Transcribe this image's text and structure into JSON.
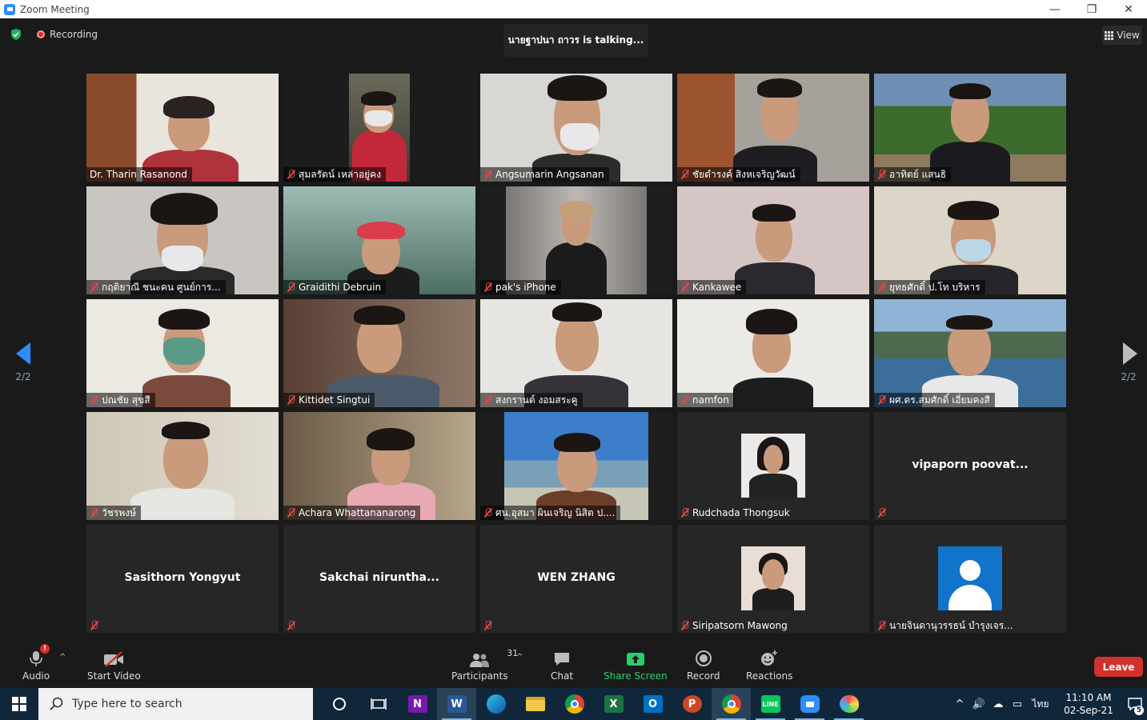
{
  "window": {
    "title": "Zoom Meeting",
    "minimize": "—",
    "maximize": "❐",
    "close": "✕"
  },
  "topbar": {
    "recording_label": "Recording",
    "talking_text": "นายฐาปนา ถาวร is talking...",
    "view_label": "View"
  },
  "pager": {
    "left": "2/2",
    "right": "2/2"
  },
  "tiles": [
    {
      "name": "Dr. Tharin Rasanond"
    },
    {
      "name": "สุมลรัตน์ เหล่าอยู่คง"
    },
    {
      "name": "Angsumarin Angsanan"
    },
    {
      "name": "ชัยดำรงค์ สิงหเจริญวัฒน์"
    },
    {
      "name": "อาทิตย์ แสนธิ"
    },
    {
      "name": "กฤติยาณี ชนะคน ศูนย์การ..."
    },
    {
      "name": "Graidithi Debruin"
    },
    {
      "name": "pak's iPhone"
    },
    {
      "name": "Kankawee"
    },
    {
      "name": "ยุทธศักดิ์ ป.โท บริหาร"
    },
    {
      "name": "ปณชัย สุขสี"
    },
    {
      "name": "Kittidet Singtui"
    },
    {
      "name": "สงกรานต์ งอมสระคู"
    },
    {
      "name": "namfon"
    },
    {
      "name": "ผศ.ดร.สมศักดิ์ เอี่ยมคงสี"
    },
    {
      "name": "วัชรพงษ์"
    },
    {
      "name": "Achara Whattananarong"
    },
    {
      "name": "ศน.อุสมา ผินเจริญ นิสิต ป...."
    },
    {
      "name": "Rudchada Thongsuk"
    },
    {
      "name": "",
      "center": "vipaporn  poovat..."
    },
    {
      "name": "",
      "center": "Sasithorn Yongyut"
    },
    {
      "name": "",
      "center": "Sakchai  niruntha..."
    },
    {
      "name": "",
      "center": "WEN ZHANG"
    },
    {
      "name": "Siripatsorn Mawong"
    },
    {
      "name": "นายจินดานุวรรธน์ บำรุงเจร..."
    }
  ],
  "toolbar": {
    "audio": "Audio",
    "start_video": "Start Video",
    "participants": "Participants",
    "participants_count": "31",
    "chat": "Chat",
    "share_screen": "Share Screen",
    "record": "Record",
    "reactions": "Reactions",
    "leave": "Leave",
    "audio_badge": "!"
  },
  "taskbar": {
    "search_placeholder": "Type here to search",
    "language": "ไทย",
    "time": "11:10 AM",
    "date": "02-Sep-21",
    "notification_count": "5",
    "apps": [
      "cortana",
      "task-view",
      "onenote",
      "word",
      "edge",
      "file-explorer",
      "chrome",
      "excel",
      "outlook",
      "powerpoint",
      "chrome-profile",
      "line",
      "zoom",
      "paint"
    ]
  },
  "colors": {
    "accent": "#2d8cff",
    "leave": "#d0312d",
    "share": "#27d06a",
    "taskbar": "#10273b"
  }
}
